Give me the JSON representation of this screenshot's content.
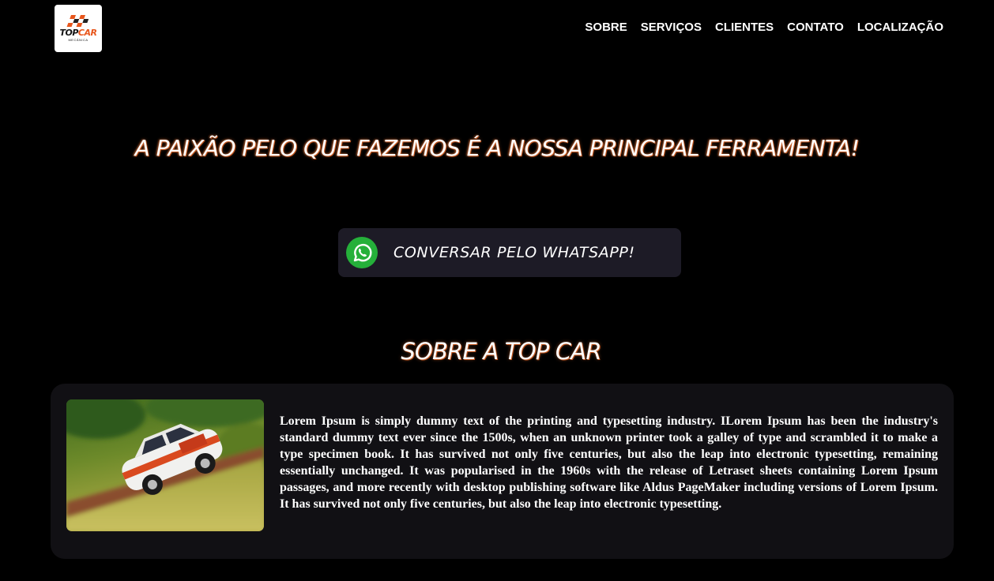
{
  "header": {
    "logo": {
      "word_top": "TOP",
      "word_car": "CAR",
      "subtitle": "MECÂNICA"
    },
    "nav": [
      "SOBRE",
      "SERVIÇOS",
      "CLIENTES",
      "CONTATO",
      "LOCALIZAÇÃO"
    ]
  },
  "hero": {
    "headline": "A PAIXÃO PELO QUE FAZEMOS É A NOSSA PRINCIPAL FERRAMENTA!",
    "whatsapp_button": {
      "label": "CONVERSAR PELO WHATSAPP!",
      "icon": "whatsapp-icon"
    }
  },
  "about": {
    "title": "SOBRE A TOP CAR",
    "text": "Lorem Ipsum is simply dummy text of the printing and typesetting industry. ILorem Ipsum has been the industry's standard dummy text ever since the 1500s, when an unknown printer took a galley of type and scrambled it to make a type specimen book. It has survived not only five centuries, but also the leap into electronic typesetting, remaining essentially unchanged. It was popularised in the 1960s with the release of Letraset sheets containing Lorem Ipsum passages, and more recently with desktop publishing software like Aldus PageMaker including versions of Lorem Ipsum. It has survived not only five centuries, but also the leap into electronic typesetting."
  },
  "colors": {
    "background": "#000000",
    "accent": "#e8561c",
    "button_bg": "#1d1b26",
    "card_bg": "#111014",
    "whatsapp_green": "#25b03a"
  }
}
